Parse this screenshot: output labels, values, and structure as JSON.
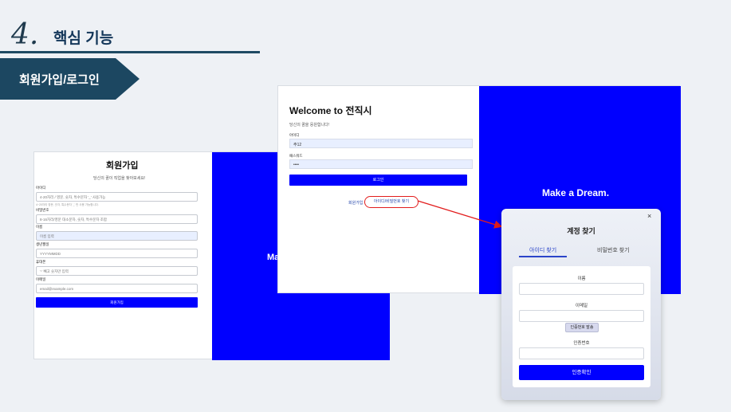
{
  "header": {
    "number": "4.",
    "title": "핵심 기능",
    "tag": "회원가입/로그인"
  },
  "signup": {
    "title": "회원가입",
    "subtitle": "당신의 꿈이 직업을 찾아보세요!",
    "fields": [
      {
        "label": "아이디",
        "placeholder": "4-20자리 / 영문, 숫자, 특수문자 '_' 사용가능",
        "hint": "4~20자리 영문, 숫자, 특수문자 '_' 만 사용 가능합니다."
      },
      {
        "label": "비밀번호",
        "placeholder": "8-16자리/영문 대소문자, 숫자, 특수문자 조합"
      },
      {
        "label": "이름",
        "placeholder": "이름 입력"
      },
      {
        "label": "생년월일",
        "placeholder": "YYYYMMDD"
      },
      {
        "label": "휴대폰",
        "placeholder": "'-' 빼고 숫자만 입력"
      },
      {
        "label": "이메일",
        "placeholder": "email@example.com"
      }
    ],
    "button": "회원가입",
    "side_text": "Ma"
  },
  "login": {
    "title": "Welcome to 전직시",
    "subtitle": "당신의 꿈을 응원합니다!",
    "id_label": "아이디",
    "id_value": "주12",
    "pw_label": "패스워드",
    "pw_value": "••••",
    "button": "로그인",
    "signup_link": "회원가입",
    "find_link": "아이디/비밀번호 찾기",
    "side_text": "Make a Dream."
  },
  "modal": {
    "close": "×",
    "title": "계정 찾기",
    "tab_id": "아이디 찾기",
    "tab_pw": "비밀번호 찾기",
    "name_label": "이름",
    "email_label": "이메일",
    "send_button": "인증번호 발송",
    "code_label": "인증번호",
    "confirm_button": "인증확인"
  },
  "colors": {
    "brand_blue": "#0000ff",
    "navy": "#1c4761",
    "annotation_red": "#e21d1d"
  }
}
